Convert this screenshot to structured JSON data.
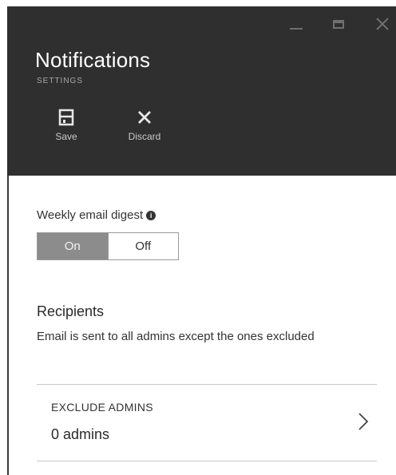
{
  "header": {
    "title": "Notifications",
    "subtitle": "SETTINGS",
    "background_color": "#2f2f2f"
  },
  "window_controls": {
    "minimize_icon": "minimize-icon",
    "maximize_icon": "maximize-icon",
    "close_icon": "close-icon"
  },
  "toolbar": {
    "save_label": "Save",
    "save_icon": "save-icon",
    "discard_label": "Discard",
    "discard_icon": "close-icon"
  },
  "digest": {
    "label": "Weekly email digest",
    "info_icon": "info-icon",
    "on_label": "On",
    "off_label": "Off",
    "selected": "On"
  },
  "recipients": {
    "title": "Recipients",
    "description": "Email is sent to all admins except the ones excluded"
  },
  "exclude": {
    "label": "EXCLUDE ADMINS",
    "value": "0 admins",
    "chevron_icon": "chevron-right-icon"
  }
}
